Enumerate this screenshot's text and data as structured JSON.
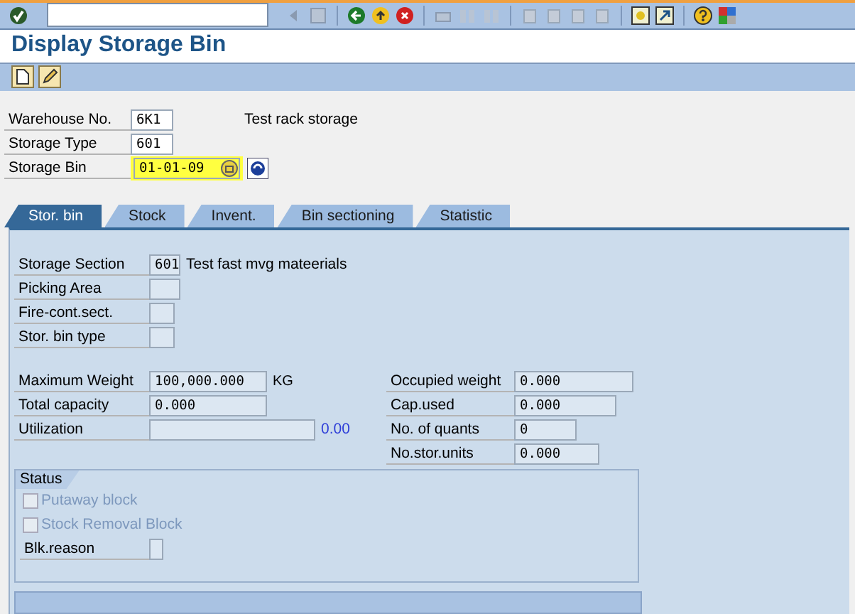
{
  "title": "Display Storage Bin",
  "header_fields": [
    {
      "label": "Warehouse No.",
      "value": "6K1",
      "description": "Test rack storage",
      "highlighted": false
    },
    {
      "label": "Storage Type",
      "value": "601",
      "highlighted": false
    },
    {
      "label": "Storage Bin",
      "value": "01-01-09",
      "highlighted": true
    }
  ],
  "tabs": [
    {
      "label": "Stor. bin",
      "selected": true
    },
    {
      "label": "Stock",
      "selected": false
    },
    {
      "label": "Invent.",
      "selected": false
    },
    {
      "label": "Bin sectioning",
      "selected": false
    },
    {
      "label": "Statistic",
      "selected": false
    }
  ],
  "bin_fields": [
    {
      "label": "Storage Section",
      "value": "601",
      "description": "Test fast mvg mateerials"
    },
    {
      "label": "Picking Area"
    },
    {
      "label": "Fire-cont.sect."
    },
    {
      "label": "Stor. bin type"
    }
  ],
  "weight_fields": [
    {
      "label": "Maximum Weight",
      "value": "100,000.000",
      "unit": "KG"
    },
    {
      "label": "Total capacity",
      "value": "0.000"
    },
    {
      "label": "Utilization",
      "reading": "0.00"
    }
  ],
  "usage_fields": [
    {
      "label": "Occupied weight",
      "value": "0.000"
    },
    {
      "label": "Cap.used",
      "value": "0.000"
    },
    {
      "label": "No. of quants",
      "value": "0"
    },
    {
      "label": "No.stor.units",
      "value": "0.000"
    }
  ],
  "status": {
    "title": "Status",
    "checkboxes": [
      {
        "label": "Putaway block",
        "checked": false,
        "disabled": true
      },
      {
        "label": "Stock Removal Block",
        "checked": false,
        "disabled": true
      }
    ],
    "fields": [
      {
        "label": "Blk.reason"
      }
    ]
  }
}
